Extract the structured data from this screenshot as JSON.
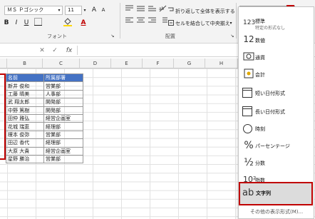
{
  "ribbon": {
    "font_name": "ＭＳ Ｐゴシック",
    "font_size": "11",
    "grow_font": "A",
    "shrink_font": "A",
    "bold": "B",
    "italic": "I",
    "underline": "U",
    "font_color": "A",
    "font_group": "フォント",
    "wrap_text": "折り返して全体を表示する",
    "merge_center": "セルを結合して中央揃え",
    "alignment_group": "配置"
  },
  "formula_bar": {
    "fx": "fx"
  },
  "columns": [
    "B",
    "C",
    "D",
    "E",
    "F",
    "G",
    "H"
  ],
  "table": {
    "headers": [
      "名前",
      "所属部署"
    ],
    "rows": [
      [
        "新井 俊和",
        "営業部"
      ],
      [
        "工藤 晴美",
        "人事部"
      ],
      [
        "武 翔太郎",
        "開発部"
      ],
      [
        "中野 篤樹",
        "開発部"
      ],
      [
        "田仲 雅弘",
        "経営企画室"
      ],
      [
        "花城 瑞恵",
        "経理部"
      ],
      [
        "榎本 俊弥",
        "営業部"
      ],
      [
        "田辺 香代",
        "経理部"
      ],
      [
        "大原 大貴",
        "経営企画室"
      ],
      [
        "星野 勝治",
        "営業部"
      ]
    ]
  },
  "number_format_menu": {
    "dropdown_arrow": "▾",
    "items": [
      {
        "icon": "123",
        "label": "標準",
        "sub": "特定の形式なし"
      },
      {
        "icon": "12",
        "label": "数値"
      },
      {
        "icon": "",
        "label": "通貨"
      },
      {
        "icon": "",
        "label": "会計"
      },
      {
        "icon": "",
        "label": "短い日付形式"
      },
      {
        "icon": "",
        "label": "長い日付形式"
      },
      {
        "icon": "",
        "label": "時刻"
      },
      {
        "icon": "%",
        "label": "パーセンテージ"
      },
      {
        "icon": "½",
        "label": "分数"
      },
      {
        "icon": "10²",
        "label": "指数"
      },
      {
        "icon": "ab",
        "label": "文字列"
      }
    ],
    "more_formats": "その他の表示形式(M)..."
  }
}
